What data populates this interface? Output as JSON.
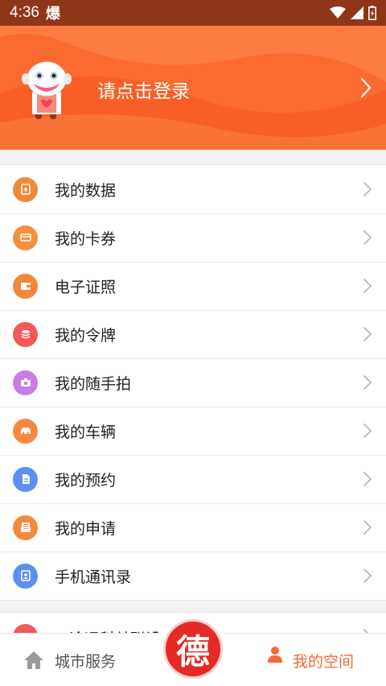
{
  "status_bar": {
    "time": "4:36",
    "app_glyph": "爆"
  },
  "header": {
    "login_text": "请点击登录"
  },
  "menu": [
    {
      "label": "我的数据",
      "icon": "data-icon",
      "color": "#f08a3a"
    },
    {
      "label": "我的卡券",
      "icon": "card-icon",
      "color": "#f5913c"
    },
    {
      "label": "电子证照",
      "icon": "wallet-icon",
      "color": "#f5873a"
    },
    {
      "label": "我的令牌",
      "icon": "token-icon",
      "color": "#f25a5a"
    },
    {
      "label": "我的随手拍",
      "icon": "camera-icon",
      "color": "#c77de6"
    },
    {
      "label": "我的车辆",
      "icon": "car-icon",
      "color": "#f5893d"
    },
    {
      "label": "我的预约",
      "icon": "document-icon",
      "color": "#5b8ff0"
    },
    {
      "label": "我的申请",
      "icon": "inbox-icon",
      "color": "#f5893d"
    },
    {
      "label": "手机通讯录",
      "icon": "contacts-icon",
      "color": "#5b8ff0"
    }
  ],
  "menu_partial": {
    "label": "一途运科关联设",
    "icon": "link-icon",
    "color": "#f25a5a"
  },
  "tabbar": {
    "city_label": "城市服务",
    "mine_label": "我的空间",
    "center_char": "德"
  },
  "colors": {
    "accent": "#fb6a30",
    "status_bar": "#8f3518",
    "center": "#e52a26"
  }
}
